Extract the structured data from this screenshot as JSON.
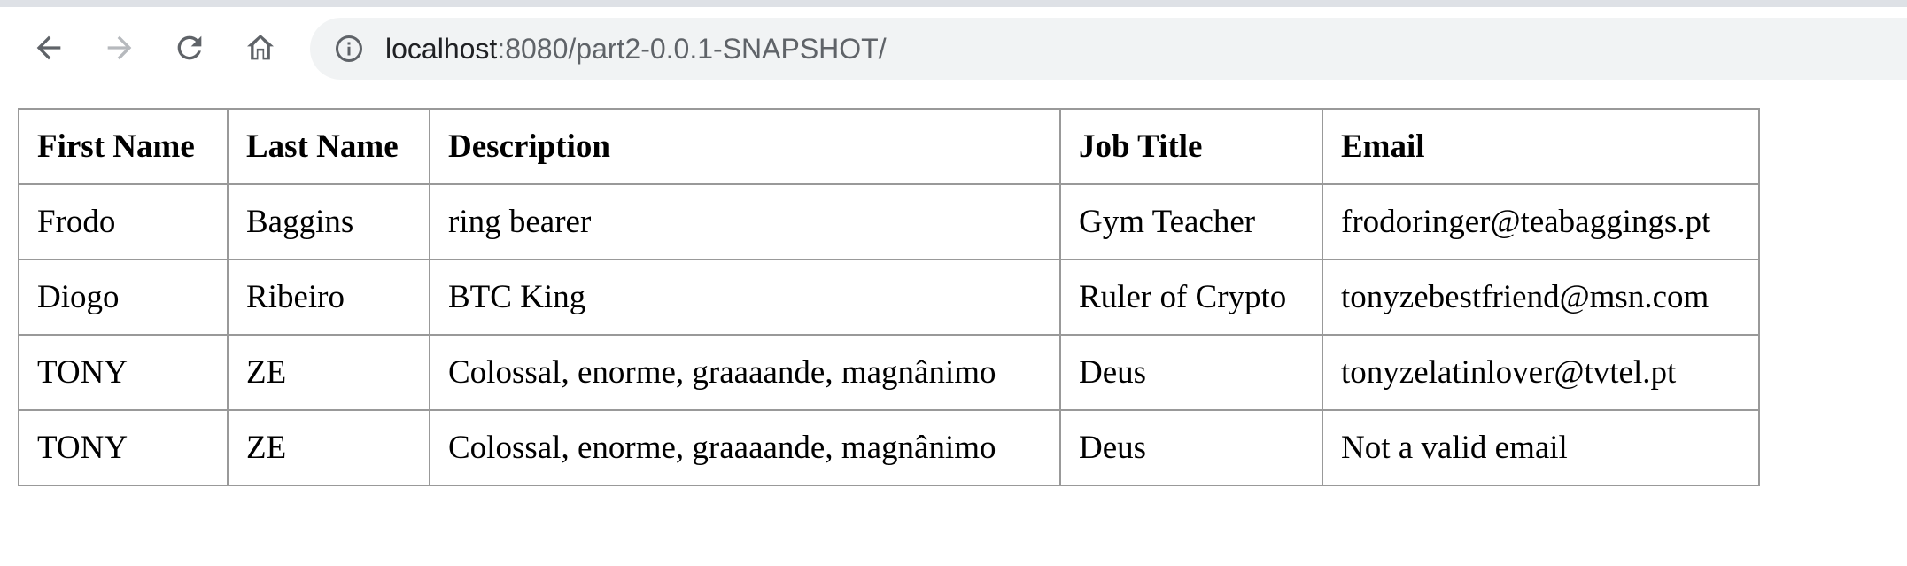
{
  "browser": {
    "url_host": "localhost",
    "url_rest": ":8080/part2-0.0.1-SNAPSHOT/",
    "icons": {
      "back": "back-arrow-icon",
      "forward": "forward-arrow-icon",
      "reload": "reload-icon",
      "home": "home-icon",
      "info": "info-icon"
    }
  },
  "table": {
    "headers": [
      "First Name",
      "Last Name",
      "Description",
      "Job Title",
      "Email"
    ],
    "rows": [
      [
        "Frodo",
        "Baggins",
        "ring bearer",
        "Gym Teacher",
        "frodoringer@teabaggings.pt"
      ],
      [
        "Diogo",
        "Ribeiro",
        "BTC King",
        "Ruler of Crypto",
        "tonyzebestfriend@msn.com"
      ],
      [
        "TONY",
        "ZE",
        "Colossal, enorme, graaaande, magnânimo",
        "Deus",
        "tonyzelatinlover@tvtel.pt"
      ],
      [
        "TONY",
        "ZE",
        "Colossal, enorme, graaaande, magnânimo",
        "Deus",
        "Not a valid email"
      ]
    ]
  },
  "colors": {
    "tabstrip": "#dee1e6",
    "omnibox": "#f1f3f4",
    "table_border": "#999999",
    "icon": "#5f6368",
    "icon_disabled": "#b6b9bd"
  }
}
